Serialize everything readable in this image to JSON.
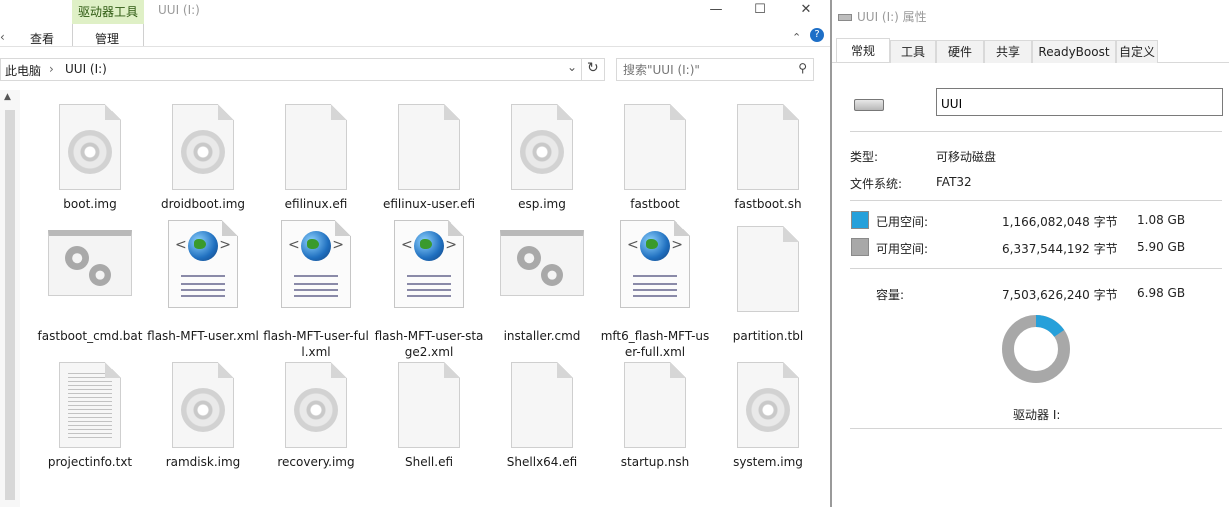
{
  "explorer": {
    "window_title": "UUI (I:)",
    "ribbon": {
      "context_group_label": "驱动器工具",
      "tab_view": "查看",
      "tab_manage": "管理"
    },
    "address": {
      "root": "此电脑",
      "separator": "›",
      "current": "UUI (I:)"
    },
    "search": {
      "placeholder": "搜索\"UUI (I:)\""
    },
    "files": [
      {
        "name": "boot.img",
        "icon": "disc-image-icon"
      },
      {
        "name": "droidboot.img",
        "icon": "disc-image-icon"
      },
      {
        "name": "efilinux.efi",
        "icon": "blank-file-icon"
      },
      {
        "name": "efilinux-user.efi",
        "icon": "blank-file-icon"
      },
      {
        "name": "esp.img",
        "icon": "disc-image-icon"
      },
      {
        "name": "fastboot",
        "icon": "blank-file-icon"
      },
      {
        "name": "fastboot.sh",
        "icon": "blank-file-icon"
      },
      {
        "name": "fastboot_cmd.bat",
        "icon": "batch-file-icon"
      },
      {
        "name": "flash-MFT-user.xml",
        "icon": "xml-file-icon"
      },
      {
        "name": "flash-MFT-user-full.xml",
        "icon": "xml-file-icon"
      },
      {
        "name": "flash-MFT-user-stage2.xml",
        "icon": "xml-file-icon"
      },
      {
        "name": "installer.cmd",
        "icon": "batch-file-icon"
      },
      {
        "name": "mft6_flash-MFT-user-full.xml",
        "icon": "xml-file-icon"
      },
      {
        "name": "partition.tbl",
        "icon": "blank-file-icon"
      },
      {
        "name": "projectinfo.txt",
        "icon": "text-file-icon"
      },
      {
        "name": "ramdisk.img",
        "icon": "disc-image-icon"
      },
      {
        "name": "recovery.img",
        "icon": "disc-image-icon"
      },
      {
        "name": "Shell.efi",
        "icon": "blank-file-icon"
      },
      {
        "name": "Shellx64.efi",
        "icon": "blank-file-icon"
      },
      {
        "name": "startup.nsh",
        "icon": "blank-file-icon"
      },
      {
        "name": "system.img",
        "icon": "disc-image-icon"
      }
    ]
  },
  "properties": {
    "title": "UUI (I:) 属性",
    "tabs": [
      "常规",
      "工具",
      "硬件",
      "共享",
      "ReadyBoost",
      "自定义"
    ],
    "active_tab": "常规",
    "volume_label": "UUI",
    "type_label": "类型:",
    "type_value": "可移动磁盘",
    "fs_label": "文件系统:",
    "fs_value": "FAT32",
    "used_label": "已用空间:",
    "used_bytes": "1,166,082,048 字节",
    "used_size": "1.08 GB",
    "free_label": "可用空间:",
    "free_bytes": "6,337,544,192 字节",
    "free_size": "5.90 GB",
    "capacity_label": "容量:",
    "capacity_bytes": "7,503,626,240 字节",
    "capacity_size": "6.98 GB",
    "drive_caption": "驱动器 I:",
    "used_fraction": 0.1554,
    "colors": {
      "used": "#26a0da",
      "free": "#a8a8a8"
    }
  }
}
